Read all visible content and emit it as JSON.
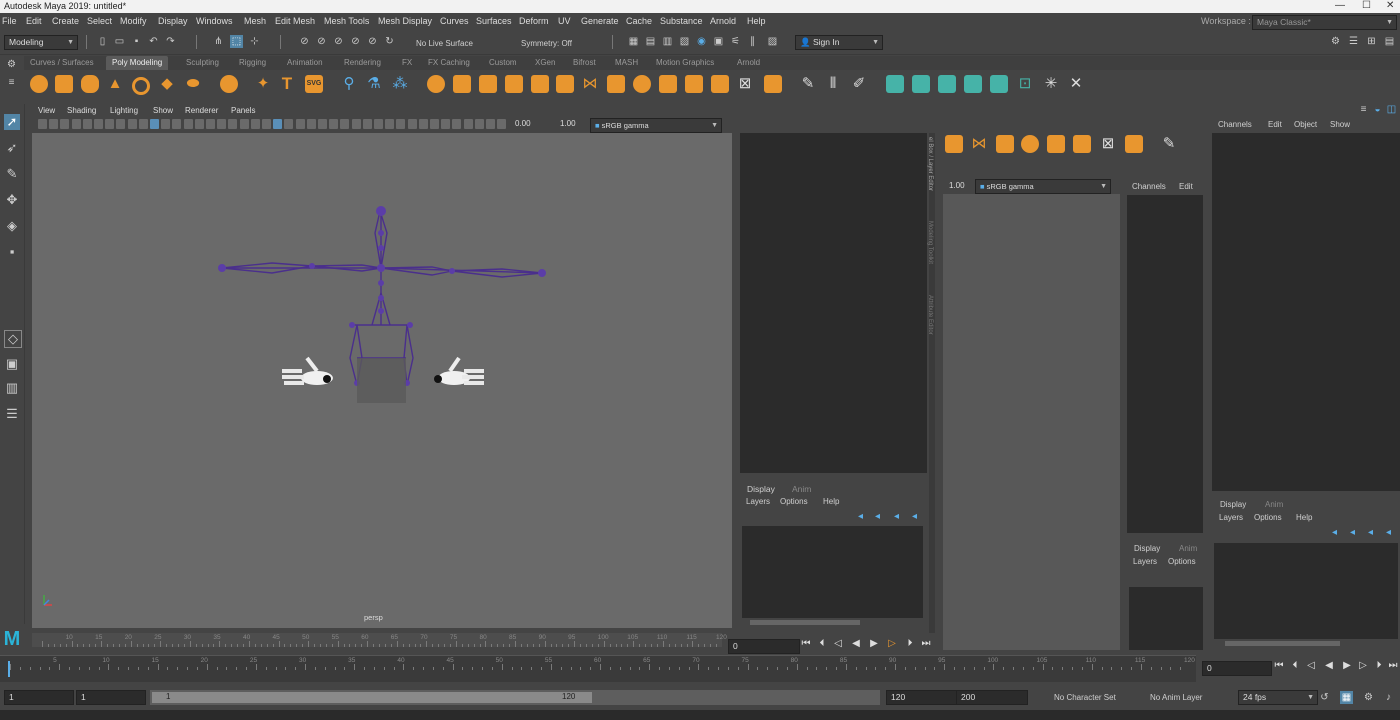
{
  "app": {
    "title": "Autodesk Maya 2019: untitled*"
  },
  "menubar": {
    "items": [
      "File",
      "Edit",
      "Create",
      "Select",
      "Modify",
      "Display",
      "Windows",
      "Mesh",
      "Edit Mesh",
      "Mesh Tools",
      "Mesh Display",
      "Curves",
      "Surfaces",
      "Deform",
      "UV",
      "Generate",
      "Cache",
      "Substance",
      "Arnold",
      "Help"
    ],
    "workspace_label": "Workspace :",
    "workspace_value": "Maya Classic*"
  },
  "statusline": {
    "mode": "Modeling",
    "live_surface": "No Live Surface",
    "symmetry": "Symmetry: Off",
    "sign_in": "Sign In"
  },
  "shelf": {
    "tabs": [
      "Curves / Surfaces",
      "Poly Modeling",
      "Sculpting",
      "Rigging",
      "Animation",
      "Rendering",
      "FX",
      "FX Caching",
      "Custom",
      "XGen",
      "Bifrost",
      "MASH",
      "Motion Graphics",
      "Arnold"
    ],
    "active_tab": "Poly Modeling",
    "text_tool": "T",
    "svg_tool": "SVG"
  },
  "viewport": {
    "menu": [
      "View",
      "Shading",
      "Lighting",
      "Show",
      "Renderer",
      "Panels"
    ],
    "exposure": "0.00",
    "gamma": "1.00",
    "color_space": "sRGB gamma",
    "camera_label": "persp"
  },
  "floating_panel": {
    "gamma": "1.00",
    "color_space": "sRGB gamma",
    "side_tabs": [
      "el Box / Layer Editor",
      "Modeling Toolkit",
      "Attribute Editor"
    ],
    "channels_menu": [
      "Channels",
      "Edit"
    ],
    "display_tabs": [
      "Display",
      "Anim"
    ],
    "layers_menu": [
      "Layers",
      "Options"
    ]
  },
  "mid_panel": {
    "display_tabs": [
      "Display",
      "Anim"
    ],
    "layers_menu": [
      "Layers",
      "Options",
      "Help"
    ]
  },
  "right_panel": {
    "channels_menu": [
      "Channels",
      "Edit",
      "Object",
      "Show"
    ],
    "display_tabs": [
      "Display",
      "Anim"
    ],
    "layers_menu": [
      "Layers",
      "Options",
      "Help"
    ]
  },
  "timeline": {
    "small_ticks": [
      "10",
      "15",
      "20",
      "25",
      "30",
      "35",
      "40",
      "45",
      "50",
      "55",
      "60",
      "65",
      "70",
      "75",
      "80",
      "85",
      "90",
      "95",
      "100",
      "105",
      "110",
      "115",
      "120"
    ],
    "small_current": "0",
    "ticks": [
      "5",
      "10",
      "15",
      "20",
      "25",
      "30",
      "35",
      "40",
      "45",
      "50",
      "55",
      "60",
      "65",
      "70",
      "75",
      "80",
      "85",
      "90",
      "95",
      "100",
      "105",
      "110",
      "115",
      "120"
    ],
    "current_frame": "0"
  },
  "range": {
    "start": "1",
    "playback_start": "1",
    "slider_start": "1",
    "slider_end": "120",
    "playback_end": "120",
    "end": "200",
    "character_set": "No Character Set",
    "anim_layer": "No Anim Layer",
    "fps": "24 fps"
  }
}
